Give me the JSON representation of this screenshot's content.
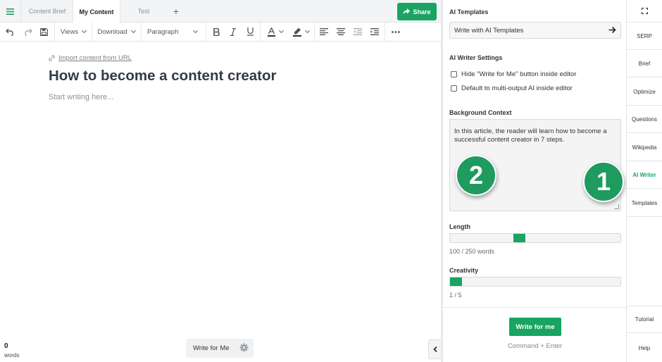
{
  "tabs": {
    "items": [
      {
        "label": "Content Brief"
      },
      {
        "label": "My Content"
      },
      {
        "label": "Test"
      }
    ],
    "add_icon": "+",
    "share_label": "Share"
  },
  "toolbar": {
    "views_label": "Views",
    "download_label": "Download",
    "paragraph_label": "Paragraph"
  },
  "editor": {
    "import_label": "Import content from URL",
    "title": "How to become a content creator",
    "placeholder": "Start writing here...",
    "word_count": "0",
    "word_count_label": "words",
    "write_for_me_label": "Write for Me"
  },
  "panel": {
    "templates_heading": "AI Templates",
    "templates_button": "Write with AI Templates",
    "settings_heading": "AI Writer Settings",
    "settings": [
      {
        "label": "Hide \"Write for Me\" button inside editor",
        "checked": false
      },
      {
        "label": "Default to multi-output AI inside editor",
        "checked": false
      }
    ],
    "context_heading": "Background Context",
    "context_text": "In this article, the reader will learn how to become a successful content creator in 7 steps.",
    "length_heading": "Length",
    "length_value": 100,
    "length_max": 250,
    "length_text": "100 / 250 words",
    "creativity_heading": "Creativity",
    "creativity_value": 1,
    "creativity_max": 5,
    "creativity_text": "1 / 5",
    "write_button": "Write for me",
    "shortcut": "Command + Enter"
  },
  "badges": [
    {
      "label": "2"
    },
    {
      "label": "1"
    }
  ],
  "sidebar": {
    "items": [
      {
        "label": "SERP"
      },
      {
        "label": "Brief"
      },
      {
        "label": "Optimize"
      },
      {
        "label": "Questions"
      },
      {
        "label": "Wikipedia"
      },
      {
        "label": "AI Writer",
        "active": true
      },
      {
        "label": "Templates"
      }
    ],
    "bottom": [
      {
        "label": "Tutorial"
      },
      {
        "label": "Help"
      }
    ]
  },
  "colors": {
    "accent": "#19a463",
    "badge": "#1f9b5f"
  }
}
